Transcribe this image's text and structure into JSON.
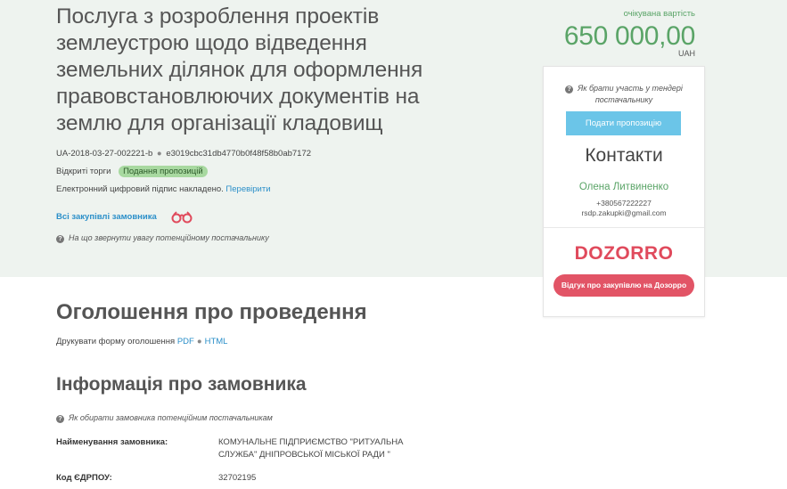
{
  "tender": {
    "title": "Послуга з розроблення проектів землеустрою щодо відведення земельних ділянок для оформлення правовстановлюючих документів на землю для організації кладовищ",
    "id": "UA-2018-03-27-002221-b",
    "hash": "e3019cbc31db4770b0f48f58b0ab7172",
    "procedure": "Відкриті торги",
    "status": "Подання пропозицій",
    "signature_text": "Електронний цифровий підпис накладено.",
    "signature_link": "Перевірити",
    "all_purchases_link": "Всі закупівлі замовника",
    "hint_attention": "На що звернути увагу потенційному постачальнику"
  },
  "price": {
    "label": "очікувана вартість",
    "value": "650 000,00",
    "currency": "UAH"
  },
  "sidebar": {
    "hint": "Як брати участь у тендері постачальнику",
    "submit_button": "Подати пропозицію",
    "contacts_title": "Контакти",
    "contact_name": "Олена Литвиненко",
    "contact_phone": "+380567222227",
    "contact_email": "rsdp.zakupki@gmail.com",
    "dozorro_logo": "DOZORRO",
    "dozorro_button": "Відгук про закупівлю на Дозорро"
  },
  "announcement": {
    "title": "Оголошення про проведення",
    "print_label": "Друкувати форму оголошення",
    "pdf_link": "PDF",
    "html_link": "HTML"
  },
  "customer": {
    "title": "Інформація про замовника",
    "hint": "Як обирати замовника потенційним постачальникам",
    "name_label": "Найменування замовника:",
    "name_value": "КОМУНАЛЬНЕ ПІДПРИЄМСТВО \"РИТУАЛЬНА СЛУЖБА\" ДНІПРОВСЬКОЇ МІСЬКОЇ РАДИ \"",
    "edrpou_label": "Код ЄДРПОУ:",
    "edrpou_value": "32702195"
  },
  "icons": {
    "question": "question-circle-icon",
    "binoculars": "binoculars-icon"
  },
  "colors": {
    "band_bg": "#eef3ef",
    "green": "#5aa467",
    "link": "#2b8fc9",
    "submit": "#6bc5e8",
    "dozorro": "#e25466"
  }
}
